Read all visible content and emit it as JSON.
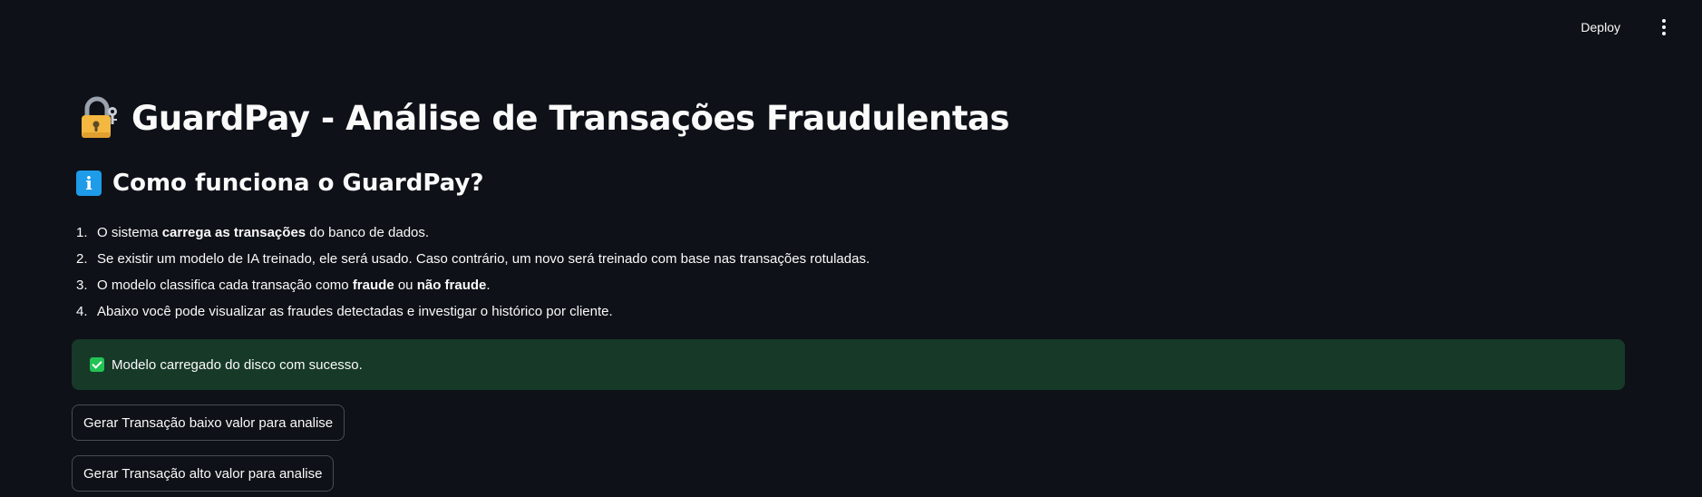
{
  "header": {
    "deploy_label": "Deploy",
    "menu_icon": "vertical-ellipsis-icon"
  },
  "page": {
    "title_icon": "lock-with-key-icon",
    "title": "GuardPay - Análise de Transações Fraudulentas",
    "section_icon": "information-icon",
    "section_title": "Como funciona o GuardPay?"
  },
  "steps": [
    {
      "num": "1.",
      "parts": [
        "O sistema ",
        "carrega as transações",
        " do banco de dados."
      ]
    },
    {
      "num": "2.",
      "text": "Se existir um modelo de IA treinado, ele será usado. Caso contrário, um novo será treinado com base nas transações rotuladas."
    },
    {
      "num": "3.",
      "parts": [
        "O modelo classifica cada transação como ",
        "fraude",
        " ou ",
        "não fraude",
        "."
      ]
    },
    {
      "num": "4.",
      "text": "Abaixo você pode visualizar as fraudes detectadas e investigar o histórico por cliente."
    }
  ],
  "alert": {
    "icon": "check-mark-icon",
    "message": "Modelo carregado do disco com sucesso.",
    "bg_color": "#173928",
    "icon_color": "#21c354"
  },
  "buttons": {
    "low_value": "Gerar Transação baixo valor para analise",
    "high_value": "Gerar Transação alto valor para analise"
  },
  "colors": {
    "background": "#0e1117",
    "text": "#fafafa",
    "info_blue": "#1e9be9",
    "lock_gold": "#f4b73f"
  }
}
